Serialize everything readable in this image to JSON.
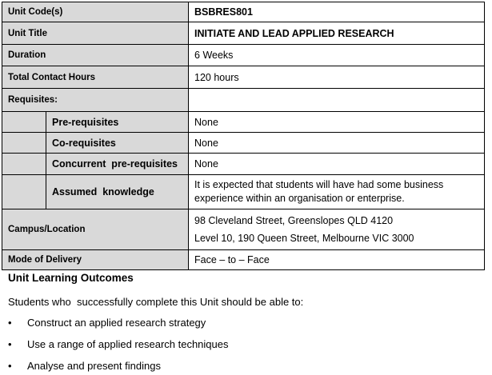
{
  "table": {
    "unit_code": {
      "label": "Unit Code(s)",
      "value": "BSBRES801"
    },
    "unit_title": {
      "label": "Unit Title",
      "value": "INITIATE AND LEAD APPLIED RESEARCH"
    },
    "duration": {
      "label": "Duration",
      "value": "6 Weeks"
    },
    "contact_hours": {
      "label": "Total Contact Hours",
      "value": "120 hours"
    },
    "requisites": {
      "label": "Requisites:",
      "items": [
        {
          "label": "Pre-requisites",
          "value": "None"
        },
        {
          "label": "Co-requisites",
          "value": "None"
        },
        {
          "label": "Concurrent  pre-requisites",
          "value": "None"
        },
        {
          "label": "Assumed  knowledge",
          "value_line1": "It is expected that students will have had some business",
          "value_line2": "experience within an organisation or enterprise."
        }
      ]
    },
    "campus": {
      "label": "Campus/Location",
      "line1": "98 Cleveland Street, Greenslopes QLD 4120",
      "line2": "Level 10, 190 Queen Street, Melbourne VIC 3000"
    },
    "delivery": {
      "label": "Mode of Delivery",
      "value": "Face – to – Face"
    }
  },
  "outcomes": {
    "heading": "Unit Learning Outcomes",
    "intro": "Students who  successfully complete this Unit should be able to:",
    "bullet_glyph": "•",
    "items": [
      "Construct an applied research strategy",
      "Use a range of applied research techniques",
      "Analyse and present findings"
    ]
  }
}
